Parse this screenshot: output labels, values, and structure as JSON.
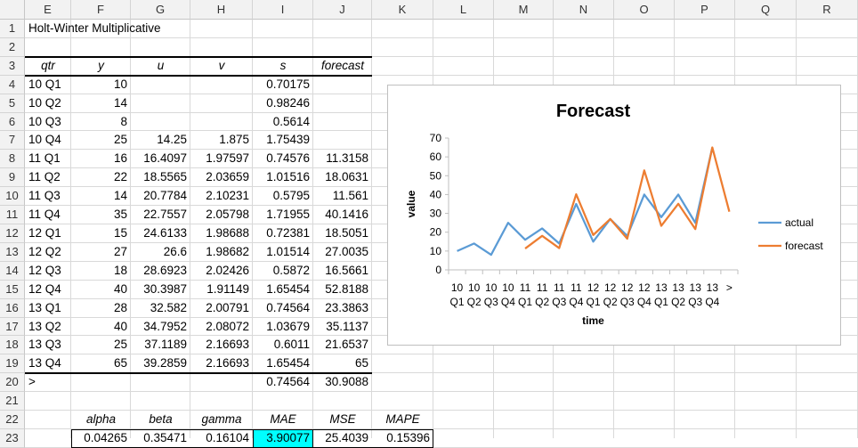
{
  "columns": [
    "E",
    "F",
    "G",
    "H",
    "I",
    "J",
    "K",
    "L",
    "M",
    "N",
    "O",
    "P",
    "Q",
    "R"
  ],
  "rows": [
    "1",
    "2",
    "3",
    "4",
    "5",
    "6",
    "7",
    "8",
    "9",
    "10",
    "11",
    "12",
    "13",
    "14",
    "15",
    "16",
    "17",
    "18",
    "19",
    "20",
    "21",
    "22",
    "23"
  ],
  "title": "Holt-Winter Multiplicative",
  "table": {
    "headers": [
      "qtr",
      "y",
      "u",
      "v",
      "s",
      "forecast"
    ],
    "rows": [
      [
        "10 Q1",
        "10",
        "",
        "",
        "0.70175",
        ""
      ],
      [
        "10 Q2",
        "14",
        "",
        "",
        "0.98246",
        ""
      ],
      [
        "10 Q3",
        "8",
        "",
        "",
        "0.5614",
        ""
      ],
      [
        "10 Q4",
        "25",
        "14.25",
        "1.875",
        "1.75439",
        ""
      ],
      [
        "11 Q1",
        "16",
        "16.4097",
        "1.97597",
        "0.74576",
        "11.3158"
      ],
      [
        "11 Q2",
        "22",
        "18.5565",
        "2.03659",
        "1.01516",
        "18.0631"
      ],
      [
        "11 Q3",
        "14",
        "20.7784",
        "2.10231",
        "0.5795",
        "11.561"
      ],
      [
        "11 Q4",
        "35",
        "22.7557",
        "2.05798",
        "1.71955",
        "40.1416"
      ],
      [
        "12 Q1",
        "15",
        "24.6133",
        "1.98688",
        "0.72381",
        "18.5051"
      ],
      [
        "12 Q2",
        "27",
        "26.6",
        "1.98682",
        "1.01514",
        "27.0035"
      ],
      [
        "12 Q3",
        "18",
        "28.6923",
        "2.02426",
        "0.5872",
        "16.5661"
      ],
      [
        "12 Q4",
        "40",
        "30.3987",
        "1.91149",
        "1.65454",
        "52.8188"
      ],
      [
        "13 Q1",
        "28",
        "32.582",
        "2.00791",
        "0.74564",
        "23.3863"
      ],
      [
        "13 Q2",
        "40",
        "34.7952",
        "2.08072",
        "1.03679",
        "35.1137"
      ],
      [
        "13 Q3",
        "25",
        "37.1189",
        "2.16693",
        "0.6011",
        "21.6537"
      ],
      [
        "13 Q4",
        "65",
        "39.2859",
        "2.16693",
        "1.65454",
        "65"
      ],
      [
        ">",
        "",
        "",
        "",
        "0.74564",
        "30.9088"
      ]
    ]
  },
  "params": {
    "labels": [
      "alpha",
      "beta",
      "gamma",
      "MAE",
      "MSE",
      "MAPE"
    ],
    "values": [
      "0.04265",
      "0.35471",
      "0.16104",
      "3.90077",
      "25.4039",
      "0.15396"
    ],
    "highlight_color": "#00ffff"
  },
  "chart_data": {
    "type": "line",
    "title": "Forecast",
    "xlabel": "time",
    "ylabel": "value",
    "ylim": [
      0,
      70
    ],
    "yticks": [
      0,
      10,
      20,
      30,
      40,
      50,
      60,
      70
    ],
    "categories": [
      [
        "10",
        "Q1"
      ],
      [
        "10",
        "Q2"
      ],
      [
        "10",
        "Q3"
      ],
      [
        "10",
        "Q4"
      ],
      [
        "11",
        "Q1"
      ],
      [
        "11",
        "Q2"
      ],
      [
        "11",
        "Q3"
      ],
      [
        "11",
        "Q4"
      ],
      [
        "12",
        "Q1"
      ],
      [
        "12",
        "Q2"
      ],
      [
        "12",
        "Q3"
      ],
      [
        "12",
        "Q4"
      ],
      [
        "13",
        "Q1"
      ],
      [
        "13",
        "Q2"
      ],
      [
        "13",
        "Q3"
      ],
      [
        "13",
        "Q4"
      ],
      [
        ">",
        ""
      ]
    ],
    "legend_position": "right",
    "series": [
      {
        "name": "actual",
        "color": "#5b9bd5",
        "values": [
          10,
          14,
          8,
          25,
          16,
          22,
          14,
          35,
          15,
          27,
          18,
          40,
          28,
          40,
          25,
          65,
          null
        ]
      },
      {
        "name": "forecast",
        "color": "#ed7d31",
        "values": [
          null,
          null,
          null,
          null,
          11.3158,
          18.0631,
          11.561,
          40.1416,
          18.5051,
          27.0035,
          16.5661,
          52.8188,
          23.3863,
          35.1137,
          21.6537,
          65,
          30.9088
        ]
      }
    ]
  }
}
